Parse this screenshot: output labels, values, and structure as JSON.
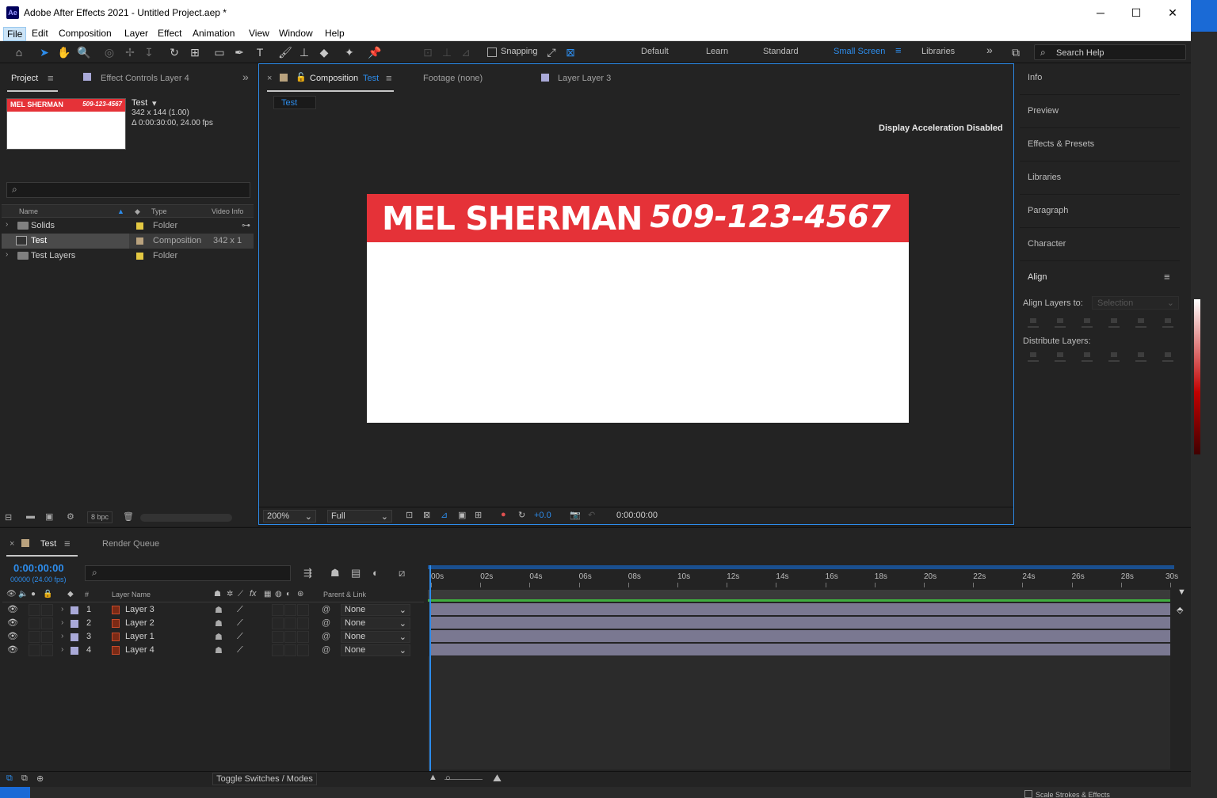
{
  "window": {
    "title": "Adobe After Effects 2021 - Untitled Project.aep *",
    "app_icon": "Ae",
    "minimize": "─",
    "maximize": "☐",
    "close": "✕"
  },
  "menu": [
    "File",
    "Edit",
    "Composition",
    "Layer",
    "Effect",
    "Animation",
    "View",
    "Window",
    "Help"
  ],
  "toolbar": {
    "snapping_label": "Snapping",
    "workspaces": [
      "Default",
      "Learn",
      "Standard",
      "Small Screen",
      "Libraries"
    ],
    "active_workspace": "Small Screen",
    "search_placeholder": "Search Help",
    "more": "»"
  },
  "project": {
    "tab_label": "Project",
    "effect_controls_tab": "Effect Controls Layer 4",
    "selected_item_name": "Test",
    "item_dims": "342 x 144 (1.00)",
    "item_duration": "Δ 0:00:30:00, 24.00 fps",
    "thumb_name": "MEL SHERMAN",
    "thumb_phone": "509-123-4567",
    "columns": {
      "name": "Name",
      "type": "Type",
      "video_info": "Video Info"
    },
    "rows": [
      {
        "name": "Solids",
        "type": "Folder",
        "video": "",
        "label_color": "#e3c842"
      },
      {
        "name": "Test",
        "type": "Composition",
        "video": "342 x 1",
        "label_color": "#b9a27e"
      },
      {
        "name": "Test Layers",
        "type": "Folder",
        "video": "",
        "label_color": "#e3c842"
      }
    ],
    "bpc": "8 bpc"
  },
  "composition": {
    "tab_prefix": "Composition",
    "tab_name": "Test",
    "footage_tab": "Footage (none)",
    "layer_tab": "Layer Layer 3",
    "subtab": "Test",
    "accel_notice": "Display Acceleration Disabled",
    "canvas_name": "MEL SHERMAN",
    "canvas_phone": "509-123-4567",
    "zoom": "200%",
    "resolution": "Full",
    "exposure": "+0.0",
    "timecode": "0:00:00:00",
    "bar_color": "#e53238"
  },
  "right_panels": {
    "items": [
      "Info",
      "Preview",
      "Effects & Presets",
      "Libraries",
      "Paragraph",
      "Character"
    ],
    "align_title": "Align",
    "align_layers_to": "Align Layers to:",
    "align_target": "Selection",
    "distribute_layers": "Distribute Layers:"
  },
  "timeline": {
    "tab_label": "Test",
    "render_queue_tab": "Render Queue",
    "current_time": "0:00:00:00",
    "frames": "00000 (24.00 fps)",
    "header": {
      "num": "#",
      "layer_name": "Layer Name",
      "parent": "Parent & Link"
    },
    "layers": [
      {
        "num": "1",
        "name": "Layer 3",
        "parent": "None"
      },
      {
        "num": "2",
        "name": "Layer 2",
        "parent": "None"
      },
      {
        "num": "3",
        "name": "Layer 1",
        "parent": "None"
      },
      {
        "num": "4",
        "name": "Layer 4",
        "parent": "None"
      }
    ],
    "ruler": [
      "00s",
      "02s",
      "04s",
      "06s",
      "08s",
      "10s",
      "12s",
      "14s",
      "16s",
      "18s",
      "20s",
      "22s",
      "24s",
      "26s",
      "28s",
      "30s"
    ],
    "toggle_label": "Toggle Switches / Modes",
    "accent": "#2d8ceb",
    "layer_bar_color": "#7a7891"
  },
  "status": {
    "scale_strokes": "Scale Strokes & Effects"
  }
}
